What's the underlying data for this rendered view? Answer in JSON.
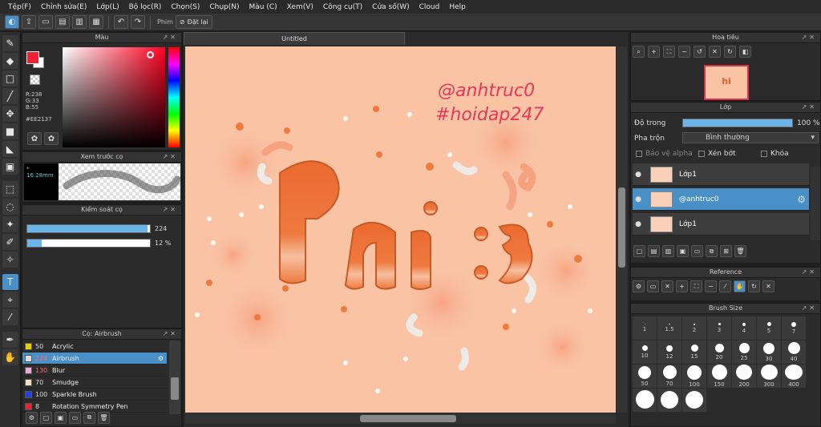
{
  "menu": [
    "Tệp(F)",
    "Chỉnh sửa(E)",
    "Lớp(L)",
    "Bộ lọc(R)",
    "Chọn(S)",
    "Chụp(N)",
    "Màu (C)",
    "Xem(V)",
    "Công cụ(T)",
    "Cửa số(W)",
    "Cloud",
    "Help"
  ],
  "toolbar": {
    "filter_label": "Phim",
    "reset_label": "Đặt lại"
  },
  "color_panel": {
    "title": "Màu",
    "r": "R:238",
    "g": "G:33",
    "b": "B:55",
    "hex": "#EE2137",
    "fg": "#EE2137"
  },
  "preview_panel": {
    "title": "Xem trước cọ",
    "size": "* 16.28mm"
  },
  "control_panel": {
    "title": "Kiểm soát cọ",
    "size_value": "224",
    "opacity_value": "12 %",
    "size_fill": 0.98,
    "opacity_fill": 0.12
  },
  "brush_panel": {
    "title": "Cọ: Airbrush",
    "items": [
      {
        "size": "50",
        "name": "Acrylic",
        "color": "#e8d000",
        "red": false
      },
      {
        "size": "224",
        "name": "Airbrush",
        "color": "#dddddd",
        "red": true
      },
      {
        "size": "130",
        "name": "Blur",
        "color": "#f0a8d8",
        "red": true
      },
      {
        "size": "70",
        "name": "Smudge",
        "color": "#f8e0c8",
        "red": false
      },
      {
        "size": "100",
        "name": "Sparkle Brush",
        "color": "#2040f0",
        "red": false
      },
      {
        "size": "8",
        "name": "Rotation Symmetry Pen",
        "color": "#ee2137",
        "red": false
      }
    ]
  },
  "canvas": {
    "tab_title": "Untitled",
    "text_line1": "@anhtruc0",
    "text_line2": "#hoidap247",
    "art_text": "hi :3"
  },
  "navigator": {
    "title": "Hoa tiêu",
    "thumb_text": "hi"
  },
  "layer_panel": {
    "title": "Lớp",
    "opacity_label": "Độ trong",
    "opacity_value": "100 %",
    "blend_label": "Pha trộn",
    "blend_value": "Bình thường",
    "protect_alpha": "Bảo vệ alpha",
    "clipping": "Xén bớt",
    "lock": "Khóa",
    "layers": [
      {
        "name": "Lớp1",
        "selected": false
      },
      {
        "name": "@anhtruc0",
        "selected": true
      },
      {
        "name": "Lớp1",
        "selected": false
      }
    ]
  },
  "reference_panel": {
    "title": "Reference"
  },
  "brushsize_panel": {
    "title": "Brush Size",
    "sizes": [
      "1",
      "1.5",
      "2",
      "3",
      "4",
      "5",
      "7",
      "10",
      "12",
      "15",
      "20",
      "25",
      "30",
      "40",
      "50",
      "70",
      "100",
      "150",
      "200",
      "300",
      "400",
      "",
      "",
      ""
    ]
  }
}
